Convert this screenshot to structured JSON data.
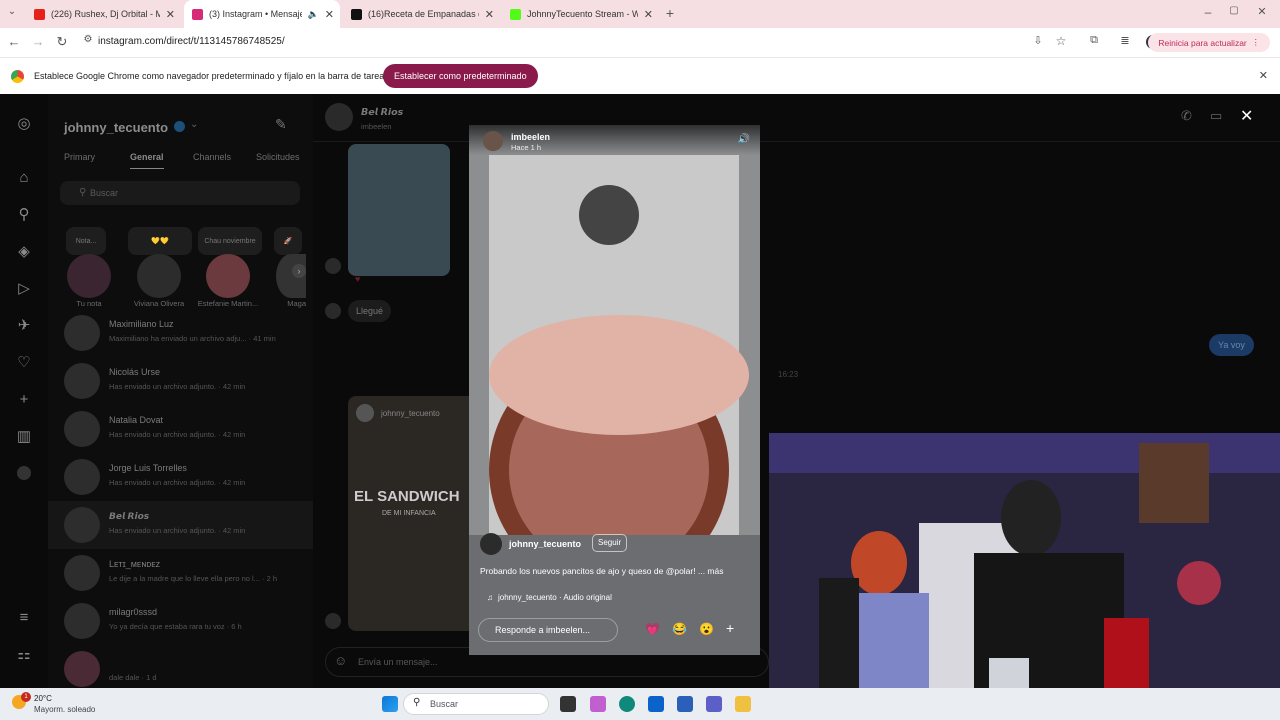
{
  "browser": {
    "tabs": [
      {
        "title": "(226) Rushex, Dj Orbital - MON",
        "color": "#e62117"
      },
      {
        "title": "(3) Instagram • Mensajes",
        "color": "#d62976",
        "active": true
      },
      {
        "title": "(16)Receta de Empanadas de C",
        "color": "#111111"
      },
      {
        "title": "JohnnyTecuento Stream - Watc",
        "color": "#53fc18"
      }
    ],
    "url": "instagram.com/direct/t/113145786748525/",
    "restart_label": "Reinicia para actualizar",
    "infobar_text": "Establece Google Chrome como navegador predeterminado y fíjalo en la barra de tareas",
    "infobar_button": "Establecer como predeterminado"
  },
  "inbox": {
    "username": "johnny_tecuento",
    "tabs": [
      "Primary",
      "General",
      "Channels",
      "Solicitudes"
    ],
    "search_placeholder": "Buscar",
    "notes": [
      {
        "label": "Nota..."
      },
      {
        "label": "💛💛"
      },
      {
        "label": "Chau noviembre"
      },
      {
        "label": "🚀"
      }
    ],
    "stories": [
      {
        "label": "Tu nota"
      },
      {
        "label": "Viviana Olivera"
      },
      {
        "label": "Estefanie Martin..."
      },
      {
        "label": "Maga"
      }
    ],
    "conversations": [
      {
        "name": "Maximiliano Luz",
        "preview": "Maximiliano ha enviado un archivo adju... · 41 min"
      },
      {
        "name": "Nicolás Urse",
        "preview": "Has enviado un archivo adjunto. · 42 min"
      },
      {
        "name": "Natalia Dovat",
        "preview": "Has enviado un archivo adjunto. · 42 min"
      },
      {
        "name": "Jorge Luis Torrelles",
        "preview": "Has enviado un archivo adjunto. · 42 min"
      },
      {
        "name": "𝘽𝙚𝙡 𝙍𝙞𝙤𝙨",
        "preview": "Has enviado un archivo adjunto. · 42 min"
      },
      {
        "name": "Lᴇᴛɪ_ᴍᴇɴᴅᴇᴢ",
        "preview": "Le dije a la madre que lo lleve ella pero no l... · 2 h"
      },
      {
        "name": "milagr0sssd",
        "preview": "Yo ya decía que estaba rara tu voz · 6 h"
      },
      {
        "name": "",
        "preview": "dale dale · 1 d"
      }
    ]
  },
  "chat": {
    "name": "𝘽𝙚𝙡 𝙍𝙞𝙤𝙨",
    "handle": "imbeelen",
    "message_llegue": "Llegué",
    "message_yavoy": "Ya voy",
    "time": "16:23",
    "shared_title": "EL SANDWICH",
    "shared_sub": "DE MI INFANCIA",
    "shared_user": "johnny_tecuento",
    "input_placeholder": "Envía un mensaje..."
  },
  "story": {
    "user": "imbeelen",
    "time": "Hace 1 h",
    "poster": "johnny_tecuento",
    "follow": "Seguir",
    "caption": "Probando los nuevos pancitos de ajo y queso de @polar! ... más",
    "audio": "johnny_tecuento · Audio original",
    "reply_placeholder": "Responde a imbeelen...",
    "reactions": [
      "💗",
      "😂",
      "😮",
      "+"
    ]
  },
  "taskbar": {
    "temp": "20°C",
    "weather": "Mayorm. soleado",
    "search": "Buscar",
    "badge": "1"
  }
}
